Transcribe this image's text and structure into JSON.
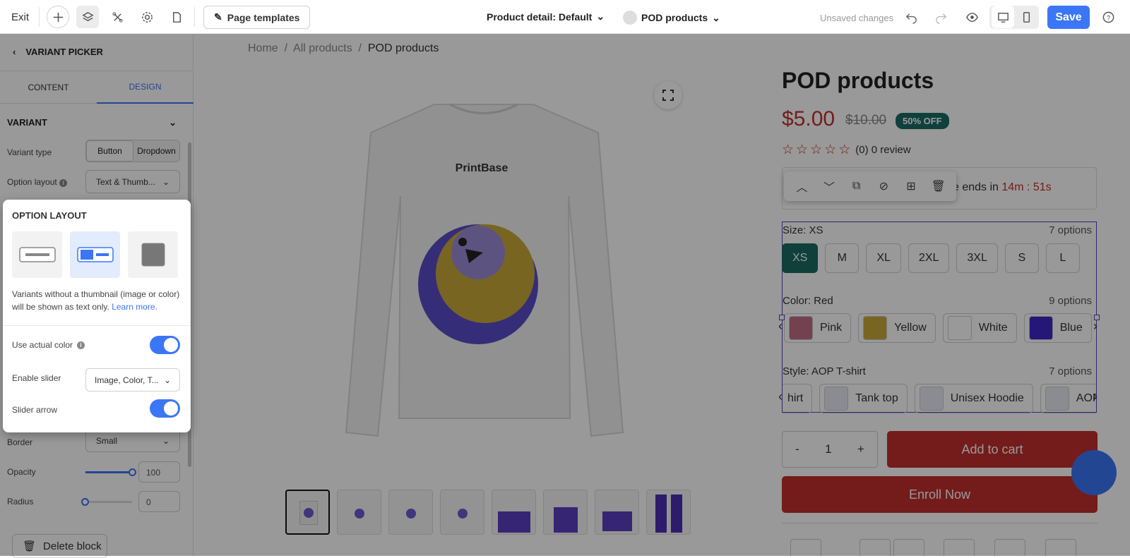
{
  "topbar": {
    "exit_label": "Exit",
    "page_templates_label": "Page templates",
    "page_selector": "Product detail: Default",
    "product_selector": "POD products",
    "unsaved_label": "Unsaved changes",
    "save_label": "Save"
  },
  "sidebar": {
    "title": "VARIANT PICKER",
    "tabs": [
      "CONTENT",
      "DESIGN"
    ],
    "section_title": "VARIANT",
    "variant_type_label": "Variant type",
    "variant_type_options": [
      "Button",
      "Dropdown"
    ],
    "option_layout_label": "Option layout",
    "option_layout_value": "Text & Thumb...",
    "border_label": "Border",
    "border_value": "Small",
    "opacity_label": "Opacity",
    "opacity_value": "100",
    "radius_label": "Radius",
    "radius_value": "0",
    "delete_label": "Delete block"
  },
  "popup": {
    "title": "OPTION LAYOUT",
    "description": "Variants without a thumbnail (image or color) will be shown as text only.",
    "learn_more": "Learn more.",
    "use_actual_color_label": "Use actual color",
    "enable_slider_label": "Enable slider",
    "enable_slider_value": "Image, Color, T...",
    "slider_arrow_label": "Slider arrow"
  },
  "preview": {
    "breadcrumbs": [
      "Home",
      "All products",
      "POD products"
    ],
    "shirt_brand": "PrintBase",
    "product_title": "POD products",
    "price": "$5.00",
    "compare_price": "$10.00",
    "discount_badge": "50% OFF",
    "reviews": "(0) 0 review",
    "timer_text": "e ends in",
    "timer_value": "14m : 51s",
    "size_label": "Size: XS",
    "size_count": "7 options",
    "sizes": [
      "XS",
      "M",
      "XL",
      "2XL",
      "3XL",
      "S",
      "L"
    ],
    "color_label": "Color: Red",
    "color_count": "9 options",
    "colors": [
      {
        "name": "Pink",
        "hex": "#c26d86"
      },
      {
        "name": "Yellow",
        "hex": "#c9a93a"
      },
      {
        "name": "White",
        "hex": "#ffffff"
      },
      {
        "name": "Blue",
        "hex": "#3c27c6"
      }
    ],
    "style_label": "Style: AOP T-shirt",
    "style_count": "7 options",
    "styles": [
      "hirt",
      "Tank top",
      "Unisex Hoodie",
      "AOP"
    ],
    "qty_minus": "-",
    "qty_value": "1",
    "qty_plus": "+",
    "add_to_cart": "Add to cart",
    "enroll": "Enroll Now"
  },
  "colors": {
    "accent": "#3b76f6",
    "price": "#c0302e",
    "badge": "#1a6c64",
    "selection": "#5a3fb8"
  }
}
